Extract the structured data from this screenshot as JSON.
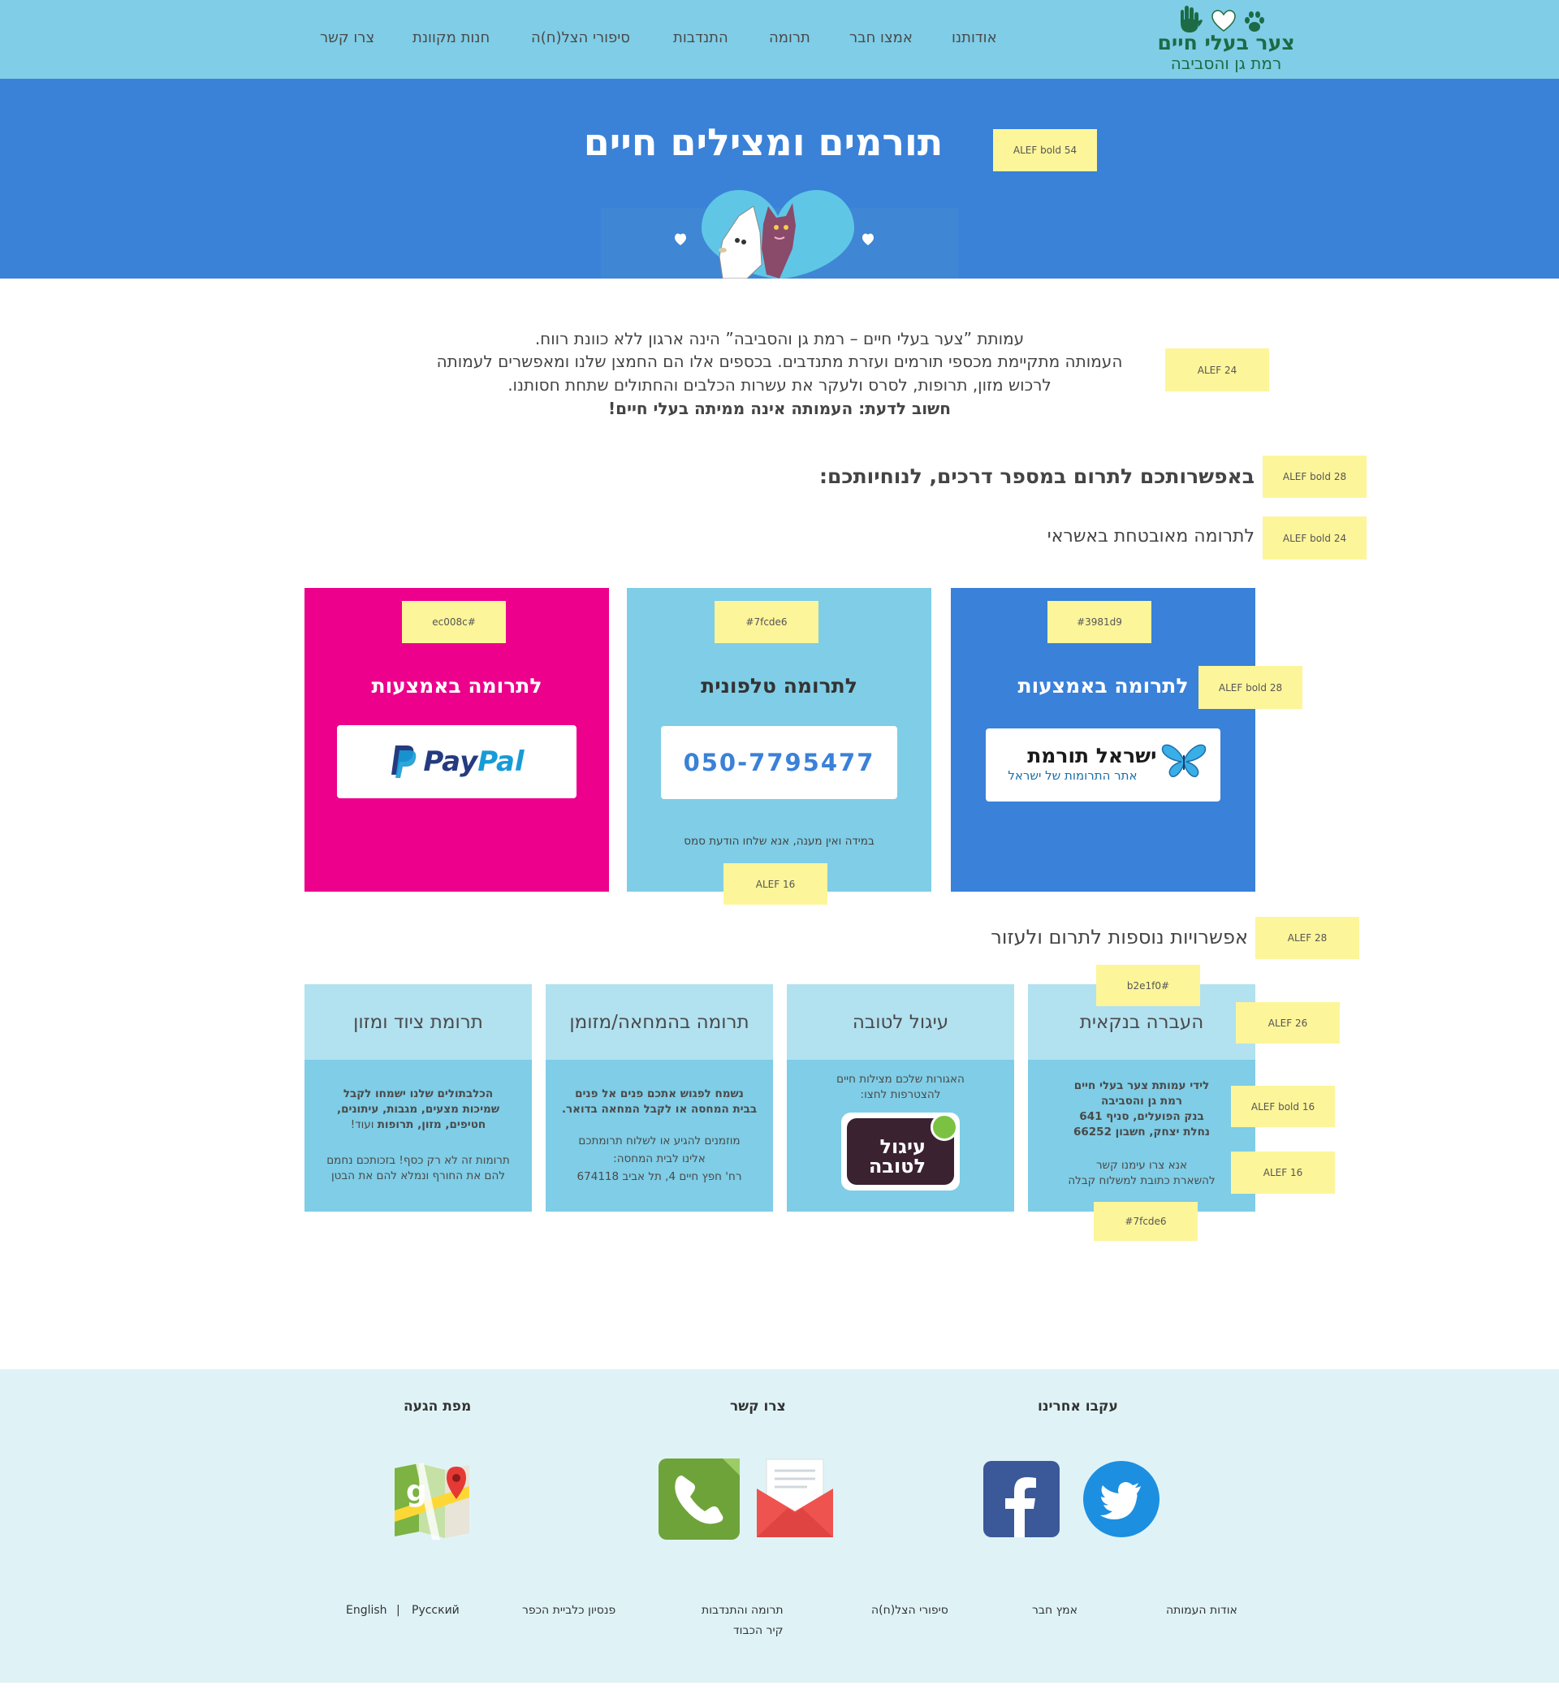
{
  "header": {
    "logo_title": "צער בעלי חיים",
    "logo_subtitle": "רמת גן והסביבה",
    "nav": [
      {
        "label": "אודותנו"
      },
      {
        "label": "אמצו חבר"
      },
      {
        "label": "תרומה"
      },
      {
        "label": "התנדבות"
      },
      {
        "label": "סיפורי הצל(ח)ה"
      },
      {
        "label": "חנות מקוונת"
      },
      {
        "label": "צרו קשר"
      }
    ]
  },
  "hero": {
    "title": "תורמים ומצילים חיים",
    "note": "ALEF bold 54"
  },
  "intro": {
    "line1": "עמותת ”צער בעלי חיים – רמת גן והסביבה” הינה ארגון ללא כוונת רווח.",
    "line2": "העמותה מתקיימת מכספי תורמים ועזרת מתנדבים. בכספים אלו הם החמצן שלנו ומאפשרים לעמותה",
    "line3": "לרכוש מזון, תרופות, לסרס ולעקר את עשרות הכלבים והחתולים שתחת חסותנו.",
    "line4": "חשוב לדעת: העמותה אינה ממיתה בעלי חיים!",
    "note": "ALEF 24"
  },
  "ways": {
    "heading": "באפשרותכם לתרום במספר דרכים, לנוחיותכם:",
    "heading_note": "ALEF bold 28",
    "subheading": "לתרומה מאובטחת באשראי",
    "subheading_note": "ALEF bold 24"
  },
  "cards": {
    "card1": {
      "title": "לתרומה באמצעות",
      "logo_main": "ישראל תורמת",
      "logo_sub": "אתר התרומות של ישראל",
      "color_note": "#3981d9",
      "title_note": "ALEF bold 28",
      "color": "#3981d9"
    },
    "card2": {
      "title": "לתרומה טלפונית",
      "phone": "050-7795477",
      "note_text": "במידה ואין מענה, אנא שלחו הודעת סמס",
      "color_note": "#7fcde6",
      "text_note": "ALEF 16",
      "color": "#7fcde6"
    },
    "card3": {
      "title": "לתרומה באמצעות",
      "paypal_1": "Pay",
      "paypal_2": "Pal",
      "color_note": "ec008c#",
      "color": "#ec008c"
    }
  },
  "more": {
    "heading": "אפשרויות נוספות לתרום ולעזור",
    "heading_note": "ALEF  28",
    "head_color_note": "b2e1f0#",
    "head_size_note": "ALEF  26",
    "bold_note": "ALEF bold 16",
    "text_note": "ALEF 16",
    "body_color_note": "#7fcde6",
    "items": [
      {
        "title": "העברה בנקאית",
        "b1": "לידי עמותת צער בעלי חיים",
        "b2": "רמת גן והסביבה",
        "b3": "בנק הפועלים, סניף 641",
        "b4": "נחלת יצחק, חשבון 66252",
        "t1": "אנא צרו עימנו קשר",
        "t2": "להשארת כתובת למשלוח קבלה"
      },
      {
        "title": "עיגול לטובה",
        "t1": "האגורות שלכם מצילות חיים",
        "t2": "להצטרפות לחצו:",
        "logo": "עיגול לטובה"
      },
      {
        "title": "תרומה בהמחאה/מזומן",
        "b1": "נשמח לפגוש אתכם פנים אל פנים",
        "b2": "בבית המחסה או לקבל המחאה בדואר.",
        "t1": "מוזמנים להגיע או לשלוח תרומתכם",
        "t2": "אלינו לבית המחסה:",
        "t3": "רח' חפץ חיים 4, תל אביב 674118"
      },
      {
        "title": "תרומת ציוד ומזון",
        "b1": "הכלבתולים שלנו ישמחו לקבל",
        "b2": "שמיכות מצעים, מגבות, עיתונים,",
        "b3": "חטיפים, מזון, תרופות",
        "b3_tail": " ועוד!",
        "t1": "תרומות זה לא רק כסף! בזכותכם נחמם",
        "t2": "להם את החורף ונמלא להם את הבטן"
      }
    ]
  },
  "footer": {
    "follow": "עקבו אחרינו",
    "contact": "צרו קשר",
    "map": "מפת  הגעה",
    "links": [
      {
        "label": "אודות  העמותה"
      },
      {
        "label": "אמץ חבר"
      },
      {
        "label": "סיפורי הצל(ח)ה"
      },
      {
        "label": "תרומה והתנדבות"
      },
      {
        "label": "קיר הכבוד"
      },
      {
        "label": "פנסיון כלביית הכפר"
      },
      {
        "label": "Русский"
      },
      {
        "label": "English"
      }
    ],
    "lang_sep": "|"
  }
}
